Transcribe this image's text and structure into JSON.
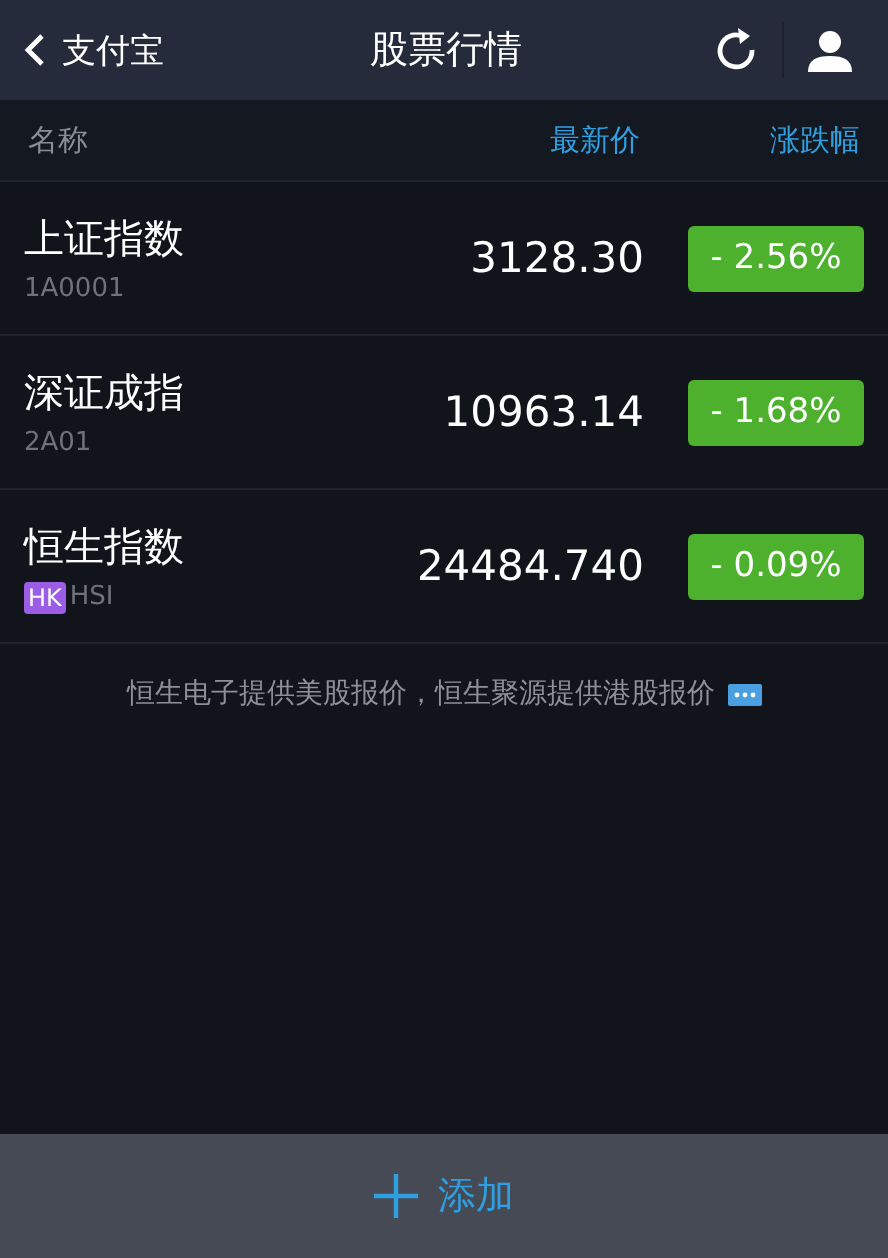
{
  "nav_bar": {
    "back_label": "支付宝",
    "title": "股票行情"
  },
  "columns": {
    "name": "名称",
    "price": "最新价",
    "change": "涨跌幅"
  },
  "stocks": [
    {
      "name": "上证指数",
      "code": "1A0001",
      "price": "3128.30",
      "change": "- 2.56%"
    },
    {
      "name": "深证成指",
      "code": "2A01",
      "price": "10963.14",
      "change": "- 1.68%"
    },
    {
      "name": "恒生指数",
      "tag": "HK",
      "code": "HSI",
      "price": "24484.740",
      "change": "- 0.09%"
    }
  ],
  "notice": "恒生电子提供美股报价，恒生聚源提供港股报价",
  "footer": {
    "add_label": "添加"
  }
}
